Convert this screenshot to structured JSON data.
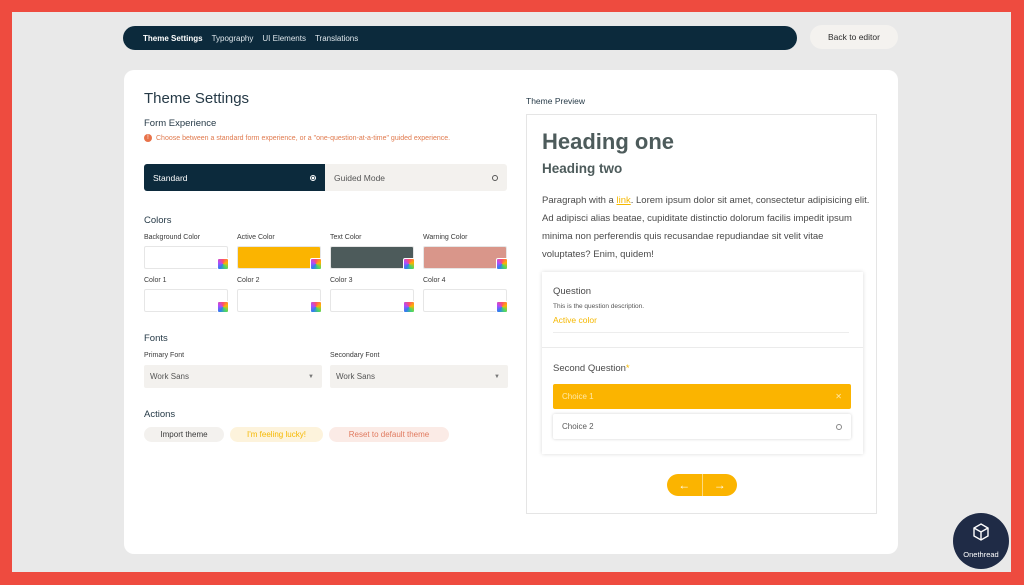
{
  "nav": {
    "tabs": [
      "Theme Settings",
      "Typography",
      "UI Elements",
      "Translations"
    ],
    "active_tab": "Theme Settings",
    "back_label": "Back to editor"
  },
  "settings": {
    "title": "Theme Settings",
    "form_experience": {
      "heading": "Form Experience",
      "hint": "Choose between a standard form experience, or a \"one-question-at-a-time\" guided experience.",
      "standard_label": "Standard",
      "guided_label": "Guided Mode",
      "selected": "Standard"
    },
    "colors": {
      "heading": "Colors",
      "items": [
        {
          "label": "Background Color",
          "value": "#ffffff"
        },
        {
          "label": "Active Color",
          "value": "#fbb400"
        },
        {
          "label": "Text Color",
          "value": "#4d5b5b"
        },
        {
          "label": "Warning Color",
          "value": "#d9968a"
        },
        {
          "label": "Color 1",
          "value": "#ffffff"
        },
        {
          "label": "Color 2",
          "value": "#ffffff"
        },
        {
          "label": "Color 3",
          "value": "#ffffff"
        },
        {
          "label": "Color 4",
          "value": "#ffffff"
        }
      ]
    },
    "fonts": {
      "heading": "Fonts",
      "primary_label": "Primary Font",
      "primary_value": "Work Sans",
      "secondary_label": "Secondary Font",
      "secondary_value": "Work Sans"
    },
    "actions": {
      "heading": "Actions",
      "import_label": "Import theme",
      "lucky_label": "I'm feeling lucky!",
      "reset_label": "Reset to default theme"
    }
  },
  "preview": {
    "label": "Theme Preview",
    "heading_one": "Heading one",
    "heading_two": "Heading two",
    "paragraph_before": "Paragraph with a ",
    "link_text": "link",
    "paragraph_after": ". Lorem ipsum dolor sit amet, consectetur adipisicing elit. Ad adipisci alias beatae, cupiditate distinctio dolorum facilis impedit ipsum minima non perferendis quis recusandae repudiandae sit velit vitae voluptates? Enim, quidem!",
    "question1_title": "Question",
    "question1_desc": "This is the question description.",
    "question1_input": "Active color",
    "question2_title": "Second Question",
    "required_mark": "*",
    "choice1": "Choice 1",
    "choice2": "Choice 2",
    "prev_arrow": "←",
    "next_arrow": "→"
  },
  "brand": {
    "watermark": "Onethread"
  }
}
